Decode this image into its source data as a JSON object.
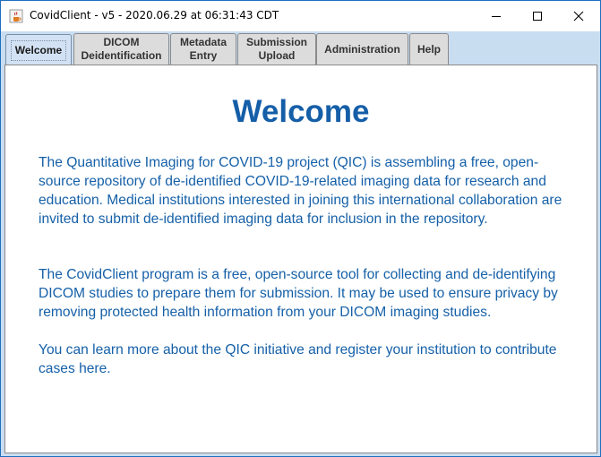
{
  "window": {
    "title": "CovidClient - v5 - 2020.06.29 at 06:31:43 CDT",
    "accent_color": "#1e6fbf"
  },
  "tabs": [
    {
      "label_line1": "Welcome",
      "label_line2": "",
      "active": true
    },
    {
      "label_line1": "DICOM",
      "label_line2": "Deidentification",
      "active": false
    },
    {
      "label_line1": "Metadata",
      "label_line2": "Entry",
      "active": false
    },
    {
      "label_line1": "Submission",
      "label_line2": "Upload",
      "active": false
    },
    {
      "label_line1": "Administration",
      "label_line2": "",
      "active": false
    },
    {
      "label_line1": "Help",
      "label_line2": "",
      "active": false
    }
  ],
  "content": {
    "heading": "Welcome",
    "text_color": "#1560a8",
    "paragraphs": [
      "The Quantitative Imaging for COVID-19 project (QIC) is assembling a free, open-source repository of de-identified COVID-19-related imaging data for research and education. Medical institutions interested in joining this international collaboration are invited to submit de-identified imaging data for inclusion in the repository.",
      "The CovidClient program is a free, open-source tool for collecting and de-identifying DICOM studies to prepare them for submission. It may be used to ensure privacy by removing protected health information from your DICOM imaging studies.",
      "You can learn more about the QIC initiative and register your institution to contribute cases here."
    ]
  },
  "icons": {
    "app": "java-cup-icon",
    "minimize": "minimize-icon",
    "maximize": "maximize-icon",
    "close": "close-icon"
  }
}
